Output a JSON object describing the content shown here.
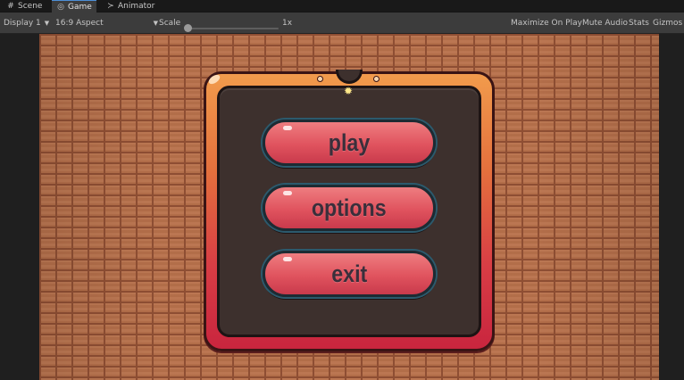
{
  "tabs": [
    {
      "icon": "grid-icon",
      "glyph": "#",
      "label": "Scene"
    },
    {
      "icon": "gamepad-icon",
      "glyph": "◎",
      "label": "Game"
    },
    {
      "icon": "animator-icon",
      "glyph": "≻",
      "label": "Animator"
    }
  ],
  "toolbar": {
    "display": "Display 1",
    "aspect": "16:9 Aspect",
    "scale_label": "Scale",
    "scale_value": "1x",
    "maximize": "Maximize On Play",
    "mute": "Mute Audio",
    "stats": "Stats",
    "gizmos": "Gizmos"
  },
  "menu": {
    "buttons": [
      "play",
      "options",
      "exit"
    ]
  },
  "colors": {
    "brick": "#b8714b",
    "panel_frame_top": "#f19b4c",
    "panel_frame_bottom": "#c9253e",
    "panel_inner": "#3d302d",
    "button_fill": "#e0535e",
    "button_text": "#3a2f3b"
  }
}
